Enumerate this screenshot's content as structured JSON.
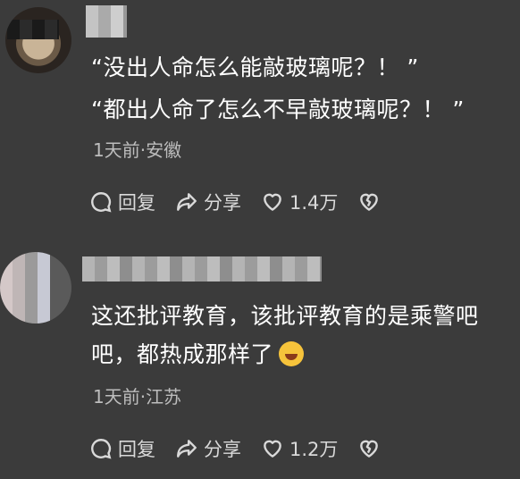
{
  "comments": [
    {
      "lines": [
        "“没出人命怎么能敲玻璃呢？！ ”",
        "“都出人命了怎么不早敲玻璃呢？！ ”"
      ],
      "meta": "1天前·安徽",
      "actions": {
        "reply": "回复",
        "share": "分享",
        "likes": "1.4万"
      }
    },
    {
      "lines": [
        "这还批评教育，该批评教育的是乘警吧",
        "吧，都热成那样了"
      ],
      "emoji": "laughing-tears-emoji",
      "meta": "1天前·江苏",
      "actions": {
        "reply": "回复",
        "share": "分享",
        "likes": "1.2万"
      }
    }
  ],
  "icons": {
    "reply": "chat-bubble-icon",
    "share": "share-arrow-icon",
    "like": "heart-icon",
    "dislike": "broken-heart-icon"
  },
  "colors": {
    "background": "#3b3b3b",
    "text": "#ffffff",
    "meta": "#bdbdbd"
  }
}
